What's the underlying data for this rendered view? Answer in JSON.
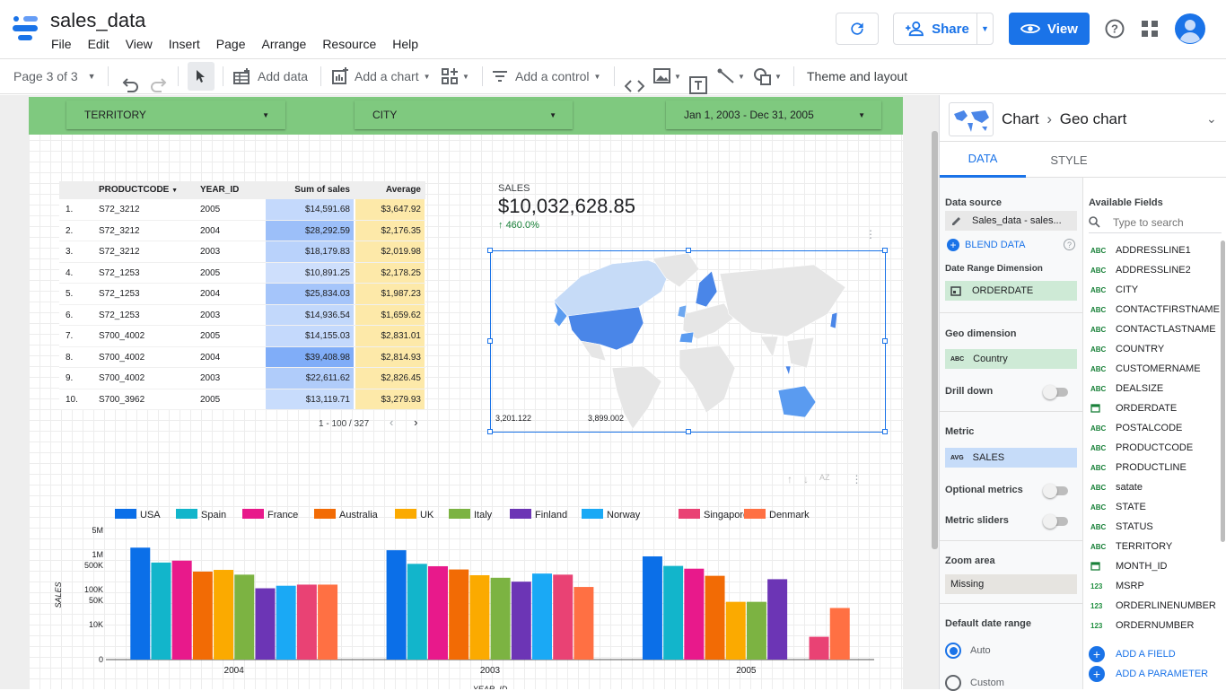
{
  "app": {
    "title": "sales_data",
    "menu": [
      "File",
      "Edit",
      "View",
      "Insert",
      "Page",
      "Arrange",
      "Resource",
      "Help"
    ],
    "share_label": "Share",
    "view_label": "View"
  },
  "toolbar": {
    "page_label": "Page 3 of 3",
    "add_data": "Add data",
    "add_chart": "Add a chart",
    "add_control": "Add a control",
    "theme": "Theme and layout"
  },
  "controls": [
    {
      "label": "TERRITORY"
    },
    {
      "label": "CITY"
    },
    {
      "label": "Jan 1, 2003 - Dec 31, 2005"
    }
  ],
  "table": {
    "headers": [
      "PRODUCTCODE",
      "YEAR_ID",
      "Sum of sales",
      "Average"
    ],
    "rows": [
      {
        "idx": "1.",
        "code": "S72_3212",
        "year": "2005",
        "sum": "$14,591.68",
        "avg": "$3,647.92",
        "sum_shade": 0.35
      },
      {
        "idx": "2.",
        "code": "S72_3212",
        "year": "2004",
        "sum": "$28,292.59",
        "avg": "$2,176.35",
        "sum_shade": 0.72
      },
      {
        "idx": "3.",
        "code": "S72_3212",
        "year": "2003",
        "sum": "$18,179.83",
        "avg": "$2,019.98",
        "sum_shade": 0.45
      },
      {
        "idx": "4.",
        "code": "S72_1253",
        "year": "2005",
        "sum": "$10,891.25",
        "avg": "$2,178.25",
        "sum_shade": 0.25
      },
      {
        "idx": "5.",
        "code": "S72_1253",
        "year": "2004",
        "sum": "$25,834.03",
        "avg": "$1,987.23",
        "sum_shade": 0.65
      },
      {
        "idx": "6.",
        "code": "S72_1253",
        "year": "2003",
        "sum": "$14,936.54",
        "avg": "$1,659.62",
        "sum_shade": 0.36
      },
      {
        "idx": "7.",
        "code": "S700_4002",
        "year": "2005",
        "sum": "$14,155.03",
        "avg": "$2,831.01",
        "sum_shade": 0.34
      },
      {
        "idx": "8.",
        "code": "S700_4002",
        "year": "2004",
        "sum": "$39,408.98",
        "avg": "$2,814.93",
        "sum_shade": 1.0
      },
      {
        "idx": "9.",
        "code": "S700_4002",
        "year": "2003",
        "sum": "$22,611.62",
        "avg": "$2,826.45",
        "sum_shade": 0.55
      },
      {
        "idx": "10.",
        "code": "S700_3962",
        "year": "2005",
        "sum": "$13,119.71",
        "avg": "$3,279.93",
        "sum_shade": 0.31
      }
    ],
    "pager": "1 - 100 / 327"
  },
  "scorecard": {
    "label": "SALES",
    "value": "$10,032,628.85",
    "delta": "460.0%"
  },
  "geo": {
    "legend_min": "3,201.122",
    "legend_max": "3,899.002"
  },
  "chart_data": {
    "type": "bar",
    "xlabel": "YEAR_ID",
    "ylabel": "SALES",
    "scale": "log",
    "yticks": [
      "5M",
      "1M",
      "500K",
      "100K",
      "50K",
      "10K",
      "0"
    ],
    "categories": [
      "2004",
      "2003",
      "2005"
    ],
    "series": [
      {
        "name": "USA",
        "color": "#0b6fe8",
        "values": [
          1600000,
          1350000,
          900000
        ]
      },
      {
        "name": "Spain",
        "color": "#12b5cb",
        "values": [
          600000,
          550000,
          480000
        ]
      },
      {
        "name": "France",
        "color": "#e8198b",
        "values": [
          680000,
          470000,
          400000
        ]
      },
      {
        "name": "Australia",
        "color": "#f26b05",
        "values": [
          330000,
          380000,
          250000
        ]
      },
      {
        "name": "UK",
        "color": "#fbaa00",
        "values": [
          370000,
          260000,
          45000
        ]
      },
      {
        "name": "Italy",
        "color": "#7cb342",
        "values": [
          270000,
          220000,
          45000
        ]
      },
      {
        "name": "Finland",
        "color": "#6c35b5",
        "values": [
          110000,
          170000,
          200000
        ]
      },
      {
        "name": "Norway",
        "color": "#1aa9f5",
        "values": [
          130000,
          290000,
          0
        ]
      },
      {
        "name": "Singapore",
        "color": "#e94274",
        "values": [
          140000,
          270000,
          4500
        ]
      },
      {
        "name": "Denmark",
        "color": "#ff7043",
        "values": [
          140000,
          120000,
          30000
        ]
      }
    ]
  },
  "panel": {
    "crumb_chart": "Chart",
    "crumb_type": "Geo chart",
    "tabs": [
      "DATA",
      "STYLE"
    ],
    "data_source_label": "Data source",
    "data_source": "Sales_data - sales...",
    "blend": "BLEND DATA",
    "date_dim_label": "Date Range Dimension",
    "date_dim": "ORDERDATE",
    "geo_dim_label": "Geo dimension",
    "geo_dim": "Country",
    "drill": "Drill down",
    "metric_label": "Metric",
    "metric": "SALES",
    "metric_agg": "AVG",
    "optional_metrics": "Optional metrics",
    "metric_sliders": "Metric sliders",
    "zoom_label": "Zoom area",
    "zoom": "Missing",
    "date_range_label": "Default date range",
    "auto": "Auto",
    "custom": "Custom",
    "available_fields": "Available Fields",
    "search_placeholder": "Type to search",
    "fields": [
      {
        "t": "ABC",
        "n": "ADDRESSLINE1"
      },
      {
        "t": "ABC",
        "n": "ADDRESSLINE2"
      },
      {
        "t": "ABC",
        "n": "CITY"
      },
      {
        "t": "ABC",
        "n": "CONTACTFIRSTNAME"
      },
      {
        "t": "ABC",
        "n": "CONTACTLASTNAME"
      },
      {
        "t": "ABC",
        "n": "COUNTRY"
      },
      {
        "t": "ABC",
        "n": "CUSTOMERNAME"
      },
      {
        "t": "ABC",
        "n": "DEALSIZE"
      },
      {
        "t": "CAL",
        "n": "ORDERDATE"
      },
      {
        "t": "ABC",
        "n": "POSTALCODE"
      },
      {
        "t": "ABC",
        "n": "PRODUCTCODE"
      },
      {
        "t": "ABC",
        "n": "PRODUCTLINE"
      },
      {
        "t": "ABC",
        "n": "satate"
      },
      {
        "t": "ABC",
        "n": "STATE"
      },
      {
        "t": "ABC",
        "n": "STATUS"
      },
      {
        "t": "ABC",
        "n": "TERRITORY"
      },
      {
        "t": "CAL",
        "n": "MONTH_ID"
      },
      {
        "t": "123",
        "n": "MSRP"
      },
      {
        "t": "123",
        "n": "ORDERLINENUMBER"
      },
      {
        "t": "123",
        "n": "ORDERNUMBER"
      }
    ],
    "add_field": "ADD A FIELD",
    "add_param": "ADD A PARAMETER"
  }
}
